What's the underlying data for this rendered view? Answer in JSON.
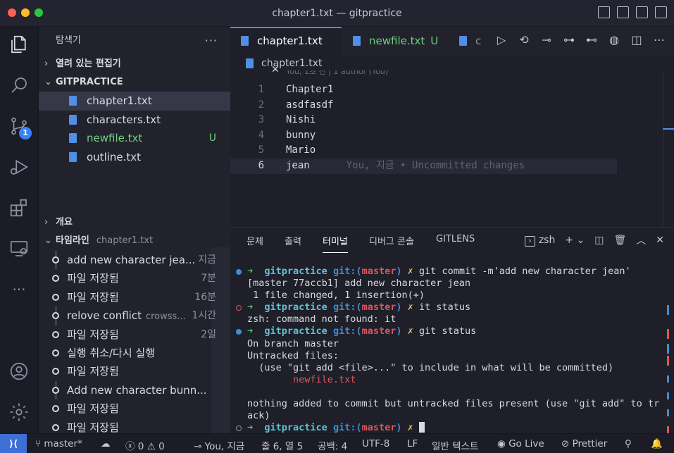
{
  "window": {
    "title": "chapter1.txt — gitpractice"
  },
  "activity_bar": {
    "scm_badge": "1",
    "icons": [
      "files-icon",
      "search-icon",
      "source-control-icon",
      "run-debug-icon",
      "extensions-icon",
      "remote-explorer-icon",
      "more-icon",
      "account-icon",
      "settings-gear-icon"
    ]
  },
  "sidebar": {
    "title": "탐색기",
    "more": "···",
    "open_editors_label": "열려 있는 편집기",
    "folder_label": "GITPRACTICE",
    "files": [
      {
        "name": "chapter1.txt",
        "status": ""
      },
      {
        "name": "characters.txt",
        "status": ""
      },
      {
        "name": "newfile.txt",
        "status": "U"
      },
      {
        "name": "outline.txt",
        "status": ""
      }
    ],
    "outline_label": "개요",
    "timeline_label": "타임라인",
    "timeline_file": "chapter1.txt",
    "timeline": [
      {
        "label": "add new character jea...",
        "sub": "",
        "time": "지금"
      },
      {
        "label": "파일 저장됨",
        "sub": "",
        "time": "7분"
      },
      {
        "label": "파일 저장됨",
        "sub": "",
        "time": "16분"
      },
      {
        "label": "relove conflict",
        "sub": "crowss...",
        "time": "1시간"
      },
      {
        "label": "파일 저장됨",
        "sub": "",
        "time": "2일"
      },
      {
        "label": "실행 취소/다시 실행",
        "sub": "",
        "time": ""
      },
      {
        "label": "파일 저장됨",
        "sub": "",
        "time": ""
      },
      {
        "label": "Add new character bunn...",
        "sub": "",
        "time": ""
      },
      {
        "label": "파일 저장됨",
        "sub": "",
        "time": ""
      },
      {
        "label": "파일 저장됨",
        "sub": "",
        "time": ""
      }
    ]
  },
  "editor": {
    "tabs": [
      {
        "label": "chapter1.txt",
        "close": "✕"
      },
      {
        "label": "newfile.txt",
        "status": "U"
      },
      {
        "label": "c"
      }
    ],
    "breadcrumb": "chapter1.txt",
    "blame_header": "You, 1초 전 | 1 author (You)",
    "lines": [
      {
        "n": "1",
        "text": "Chapter1"
      },
      {
        "n": "2",
        "text": "asdfasdf"
      },
      {
        "n": "3",
        "text": "Nishi"
      },
      {
        "n": "4",
        "text": "bunny"
      },
      {
        "n": "5",
        "text": "Mario"
      },
      {
        "n": "6",
        "text": "jean",
        "hint": "You, 지금 • Uncommitted changes"
      }
    ]
  },
  "panel": {
    "tabs": [
      "문제",
      "출력",
      "터미널",
      "디버그 콘솔",
      "GITLENS"
    ],
    "active_tab": "터미널",
    "shell": "zsh",
    "terminal": {
      "repo": "gitpractice",
      "git_prefix": "git:(",
      "branch": "master",
      "git_suffix": ")",
      "x": "✗",
      "arrow": "➜",
      "cmd1": " git commit -m'add new character jean'",
      "out1": "[master 77accb1] add new character jean",
      "out2": " 1 file changed, 1 insertion(+)",
      "cmd2": " it status",
      "out3": "zsh: command not found: it",
      "cmd3": " git status",
      "out4": "On branch master",
      "out5": "Untracked files:",
      "out6": "  (use \"git add <file>...\" to include in what will be committed)",
      "out7": "        newfile.txt",
      "out8": "nothing added to commit but untracked files present (use \"git add\" to tr",
      "out9": "ack)"
    }
  },
  "statusbar": {
    "branch": "master*",
    "errors": "0",
    "warnings": "0",
    "blame": "You, 지금",
    "position": "줄 6, 열 5",
    "spaces": "공백: 4",
    "encoding": "UTF-8",
    "eol": "LF",
    "language": "일반 텍스트",
    "golive": "Go Live",
    "prettier": "Prettier"
  },
  "colors": {
    "accent": "#4f8fe6",
    "untracked": "#6fcf7c",
    "branch": "#e0545b",
    "repo": "#5ec4d6"
  }
}
